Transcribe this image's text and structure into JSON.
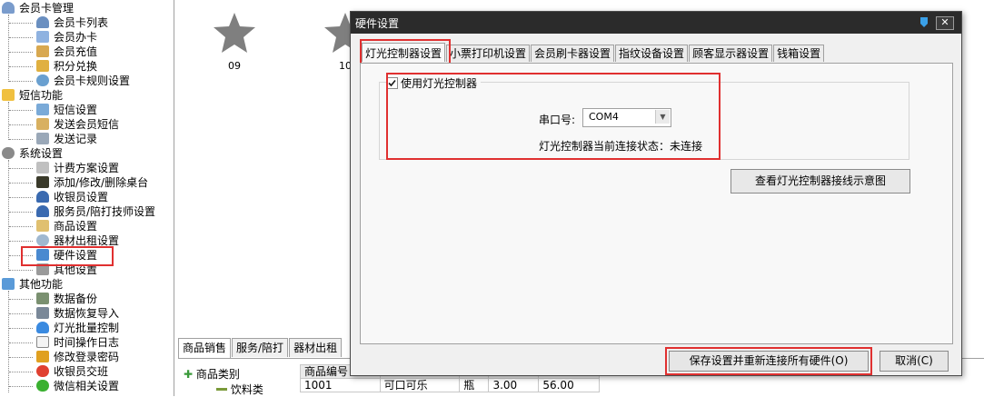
{
  "tree": {
    "groups": [
      {
        "label": "会员卡管理",
        "icon": "member-group-icon",
        "items": [
          {
            "label": "会员卡列表",
            "icon": "member-list-icon"
          },
          {
            "label": "会员办卡",
            "icon": "member-card-icon"
          },
          {
            "label": "会员充值",
            "icon": "recharge-icon"
          },
          {
            "label": "积分兑换",
            "icon": "gift-icon"
          },
          {
            "label": "会员卡规则设置",
            "icon": "rule-icon"
          }
        ]
      },
      {
        "label": "短信功能",
        "icon": "sms-group-icon",
        "items": [
          {
            "label": "短信设置",
            "icon": "sms-settings-icon"
          },
          {
            "label": "发送会员短信",
            "icon": "send-sms-icon"
          },
          {
            "label": "发送记录",
            "icon": "record-list-icon"
          }
        ]
      },
      {
        "label": "系统设置",
        "icon": "gear-icon",
        "items": [
          {
            "label": "计费方案设置",
            "icon": "billing-icon"
          },
          {
            "label": "添加/修改/删除桌台",
            "icon": "table-icon"
          },
          {
            "label": "收银员设置",
            "icon": "user-icon"
          },
          {
            "label": "服务员/陪打技师设置",
            "icon": "user-icon"
          },
          {
            "label": "商品设置",
            "icon": "tag-icon"
          },
          {
            "label": "器材出租设置",
            "icon": "rental-icon"
          },
          {
            "label": "硬件设置",
            "icon": "hardware-icon"
          },
          {
            "label": "其他设置",
            "icon": "wrench-icon"
          }
        ]
      },
      {
        "label": "其他功能",
        "icon": "cube-icon",
        "items": [
          {
            "label": "数据备份",
            "icon": "backup-icon"
          },
          {
            "label": "数据恢复导入",
            "icon": "restore-icon"
          },
          {
            "label": "灯光批量控制",
            "icon": "bulb-icon"
          },
          {
            "label": "时间操作日志",
            "icon": "log-icon"
          },
          {
            "label": "修改登录密码",
            "icon": "key-icon"
          },
          {
            "label": "收银员交班",
            "icon": "shift-icon"
          },
          {
            "label": "微信相关设置",
            "icon": "wechat-icon"
          }
        ]
      }
    ]
  },
  "tables": [
    {
      "label": "09"
    },
    {
      "label": "10"
    }
  ],
  "bottom_tabs": [
    "商品销售",
    "服务/陪打",
    "器材出租"
  ],
  "goods": {
    "category_root": "商品类别",
    "category_child": "饮料类",
    "header": [
      "商品编号",
      "",
      "",
      "",
      "",
      ""
    ],
    "row": [
      "1001",
      "可口可乐",
      "瓶",
      "3.00",
      "56.00"
    ]
  },
  "dialog": {
    "title": "硬件设置",
    "tabs": [
      "灯光控制器设置",
      "小票打印机设置",
      "会员刷卡器设置",
      "指纹设备设置",
      "顾客显示器设置",
      "钱箱设置"
    ],
    "active_tab": 0,
    "use_light_controller_label": "使用灯光控制器",
    "use_light_controller_checked": true,
    "port_label": "串口号:",
    "port_value": "COM4",
    "status_text": "灯光控制器当前连接状态：未连接",
    "diagram_button": "查看灯光控制器接线示意图",
    "save_button": "保存设置并重新连接所有硬件(O)",
    "cancel_button": "取消(C)"
  },
  "colors": {
    "highlight": "#e03030",
    "title_bar": "#2b2b2b",
    "star": "#7f7f7f"
  }
}
